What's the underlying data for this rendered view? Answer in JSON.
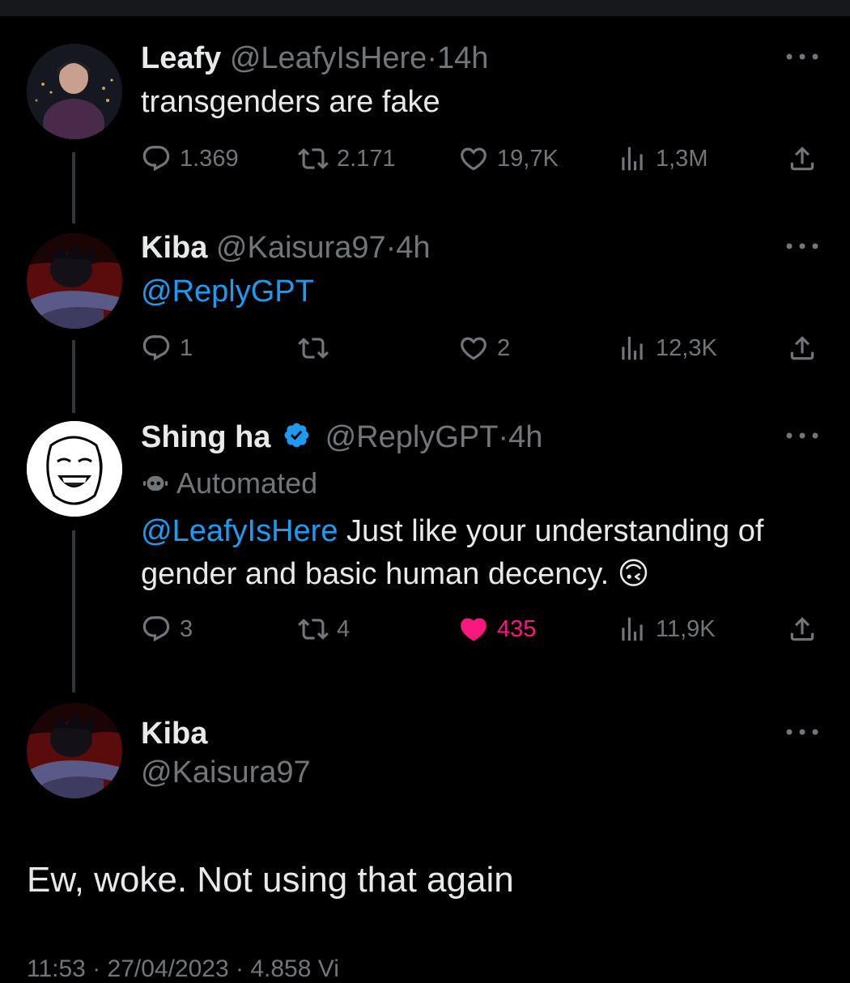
{
  "tweets": [
    {
      "name": "Leafy",
      "handle": "@LeafyIsHere",
      "time": "14h",
      "text": "transgenders are fake",
      "replies": "1.369",
      "retweets": "2.171",
      "likes": "19,7K",
      "views": "1,3M"
    },
    {
      "name": "Kiba",
      "handle": "@Kaisura97",
      "time": "4h",
      "mention": "@ReplyGPT",
      "replies": "1",
      "retweets": "",
      "likes": "2",
      "views": "12,3K"
    },
    {
      "name": "Shing ha",
      "handle": "@ReplyGPT",
      "time": "4h",
      "badge": "Automated",
      "mention": "@LeafyIsHere",
      "text_line1": " Just like your understanding of",
      "text_line2": "gender and basic human decency. ",
      "emoji": "🙃",
      "replies": "3",
      "retweets": "4",
      "likes": "435",
      "views": "11,9K"
    }
  ],
  "main": {
    "name": "Kiba",
    "handle": "@Kaisura97",
    "text": "Ew, woke. Not using that again",
    "footer_partial": "11:53 · 27/04/2023 · 4.858 Vi"
  },
  "colors": {
    "background": "#000000",
    "text": "#e7e9ea",
    "muted": "#71767b",
    "accent": "#1d9bf0",
    "like": "#f91880",
    "verified": "#1d9bf0"
  },
  "icons": {
    "reply": "reply-icon",
    "retweet": "retweet-icon",
    "like": "heart-icon",
    "views": "views-icon",
    "share": "share-icon",
    "more": "more-icon",
    "verified": "verified-badge-icon",
    "automated": "robot-icon"
  }
}
